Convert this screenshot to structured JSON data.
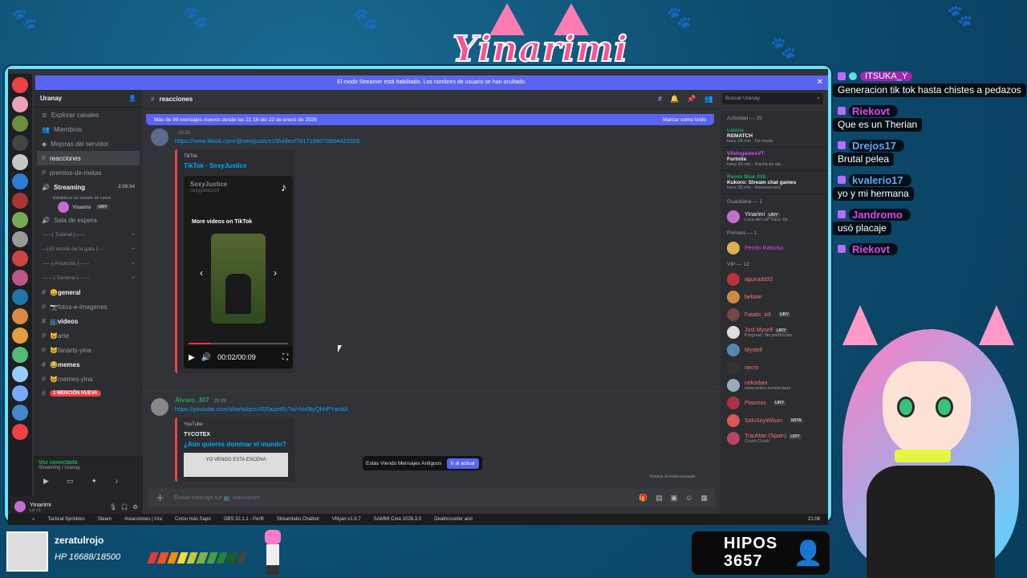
{
  "discord": {
    "banner": "El modo Streamer está habilitado. Los nombres de usuario se han ocultado.",
    "server_name": "Uranay",
    "channel_name": "reacciones",
    "search_placeholder": "Buscar Uranay",
    "new_messages": "Más de 99 mensajes nuevos desde las 21:16 del 22 de enero de 2026",
    "mark_read": "Marcar como leído",
    "nav": [
      "Explorar canales",
      "Miembros",
      "Mejoras del servidor"
    ],
    "channels": [
      {
        "label": "reacciones",
        "active": true
      },
      {
        "label": "premios-de-metas"
      },
      {
        "label": "Streaming",
        "voice": true,
        "time": "2:08:54",
        "status": "Establece un estado de canal"
      },
      {
        "label": "Sala de espera"
      },
      {
        "label": "------| Tutorial |------",
        "category": true
      },
      {
        "label": "---| El rincón de la gata |---",
        "category": true
      },
      {
        "label": "------| Anuncios |------",
        "category": true
      },
      {
        "label": "-------| General |-------",
        "category": true
      },
      {
        "label": "😀general",
        "bold": true
      },
      {
        "label": "📷fotos-e-imagenes"
      },
      {
        "label": "📺videos",
        "bold": true
      },
      {
        "label": "😺arte"
      },
      {
        "label": "😺fanarts-yina"
      },
      {
        "label": "😂memes",
        "bold": true
      },
      {
        "label": "😺memes-yina"
      },
      {
        "label": "1 MENCIÓN NUEVA",
        "mention": true
      }
    ],
    "voice_user": "Yinarimi",
    "voice_user_tag": "URY",
    "voice_connected": "Voz conectada",
    "voice_where": "Streaming / Uranay",
    "self_name": "Yinarimi",
    "self_status": "Lo +1",
    "messages": [
      {
        "author": "",
        "time": "20:29",
        "link": "https://www.tiktok.com/@sexyjustice19/video/7617188070894423326",
        "embed_provider": "TikTok",
        "embed_title": "TikTok · SexyJustice",
        "video_user": "SexyJustice",
        "video_handle": "sexyjustice19",
        "video_overlay": "More videos on TikTok",
        "video_time": "00:02/00:09",
        "video_progress": 0.22
      },
      {
        "author": "Alvaro_307",
        "time": "20:29",
        "link": "https://youtube.com/shorts/qnsXERasmRc?si=hIx9tyQhhPYarstA",
        "embed_provider": "YouTube",
        "embed_author": "TYCOTEX",
        "embed_title": "¿Aún quieres dominar el mundo?",
        "thumb_text": "YO VENGO ESTA ESCENA"
      }
    ],
    "old_messages": "Estás Viendo Mensajes Antiguos",
    "jump_label": "Ir al actual",
    "composer_placeholder": "Enviar mensaje a # 📺 reacciones",
    "immune_note": "Inmune al modo pausado",
    "activity_title": "Actividad — 29",
    "activities": [
      {
        "name": "Lalosa",
        "game": "REMATCH",
        "meta": "hace 28 min · De moda"
      },
      {
        "name": "VitelogamesVT",
        "game": "Fortnite",
        "meta": "hace 33 min · Racha de ale..."
      },
      {
        "name": "Raven Blue 018",
        "game": "Kukoro: Stream chat games",
        "meta": "hace 35 min · Resurrección"
      }
    ],
    "groups": [
      {
        "title": "Guardiana — 1",
        "members": [
          {
            "name": "Yinarimi",
            "tag": "URY",
            "sub": "Loca del cat* hace Str...",
            "color": "#f2f3f5"
          }
        ]
      },
      {
        "title": "Prinnies — 1",
        "members": [
          {
            "name": "Perrito Rabioso",
            "color": "#d946ef"
          }
        ]
      },
      {
        "title": "VIP — 12",
        "members": [
          {
            "name": "aguirado92",
            "color": "#f97373"
          },
          {
            "name": "bebote",
            "color": "#f97373"
          },
          {
            "name": "Fatalis_kill",
            "tag": "URY",
            "color": "#f97373"
          },
          {
            "name": "Just Myself",
            "tag": "URY",
            "sub": "Progreso. No perfección.",
            "color": "#f97373"
          },
          {
            "name": "Mystell",
            "color": "#f97373"
          },
          {
            "name": "necro",
            "color": "#f97373"
          },
          {
            "name": "nekodani",
            "sub": "www.twitch.tv/nekodani",
            "color": "#f97373"
          },
          {
            "name": "Plasmos",
            "tag": "URY",
            "color": "#f97373"
          },
          {
            "name": "SoloSoyWilson",
            "tag": "MITA",
            "color": "#f97373"
          },
          {
            "name": "TrauMan (Spain)",
            "tag": "URY",
            "sub": "Crush Crush",
            "color": "#f97373"
          }
        ]
      }
    ],
    "taskbar": [
      "Tactical Sprinkles",
      "Steam",
      "#reacciones | Ura",
      "Como más Sapo",
      "OBS 32.1.1 - Perfil",
      "Streamlabs Chatbot",
      "VNyan v1.6.7",
      "SAMMI Core 2026.3.0",
      "Deathcounter and",
      "21:08"
    ]
  },
  "stream_chat": [
    {
      "user": "",
      "text": "Generacion tik tok hasta chistes a pedazos",
      "color": "#d946ef"
    },
    {
      "user": "Riekovt",
      "text": "Que es un Therian",
      "color": "#d946ef"
    },
    {
      "user": "Drejos17",
      "text": "Brutal pelea",
      "color": "#60a5fa"
    },
    {
      "user": "kvalerio17",
      "text": "yo y mi hermana",
      "color": "#60a5fa"
    },
    {
      "user": "Jandromo",
      "text": "usó placaje",
      "color": "#d946ef"
    },
    {
      "user": "Riekovt",
      "text": "",
      "color": "#d946ef"
    }
  ],
  "overlay": {
    "logo": "Yinarimi",
    "player_name": "zeratulrojo",
    "player_hp": "HP 16688/18500",
    "hp_fraction": 0.9,
    "hipos_label": "HIPOS",
    "hipos_count": "3657"
  },
  "colors": {
    "accent": "#5865f2",
    "overlay_border": "#69e2f7",
    "brand_pink": "#ff4f93"
  }
}
